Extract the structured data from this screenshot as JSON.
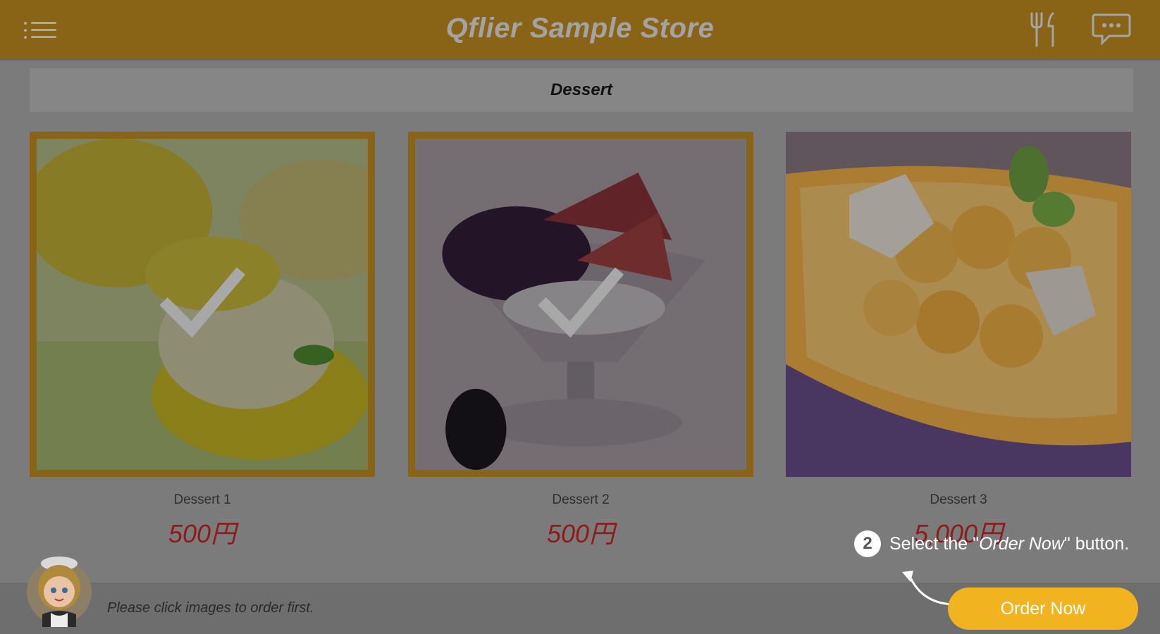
{
  "header": {
    "title": "Qflier Sample Store"
  },
  "category": {
    "title": "Dessert"
  },
  "products": [
    {
      "name": "Dessert 1",
      "price": "500円",
      "selected": true
    },
    {
      "name": "Dessert 2",
      "price": "500円",
      "selected": true
    },
    {
      "name": "Dessert 3",
      "price": "5,000円",
      "selected": false
    }
  ],
  "tutorial": {
    "step": "2",
    "text_before": "Select the \"",
    "text_em": "Order Now",
    "text_after": "\" button."
  },
  "footer": {
    "hint": "Please click images to order first.",
    "order_button": "Order Now"
  },
  "colors": {
    "header": "#8a6416",
    "accent": "#f2b320",
    "price": "#8e1a1a"
  },
  "icons": [
    "menu-icon",
    "cutlery-icon",
    "chat-icon",
    "checkmark-icon",
    "waitress-avatar",
    "curved-arrow-icon"
  ]
}
